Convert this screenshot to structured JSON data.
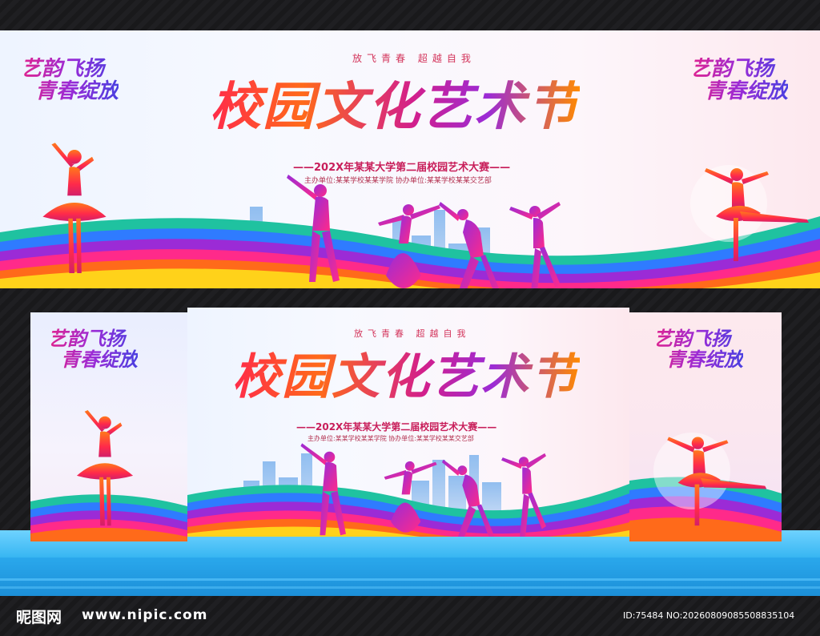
{
  "banner": {
    "slogan_line1": "艺韵飞扬",
    "slogan_line2": "青春绽放",
    "tagline": "放飞青春  超越自我",
    "title": "校园文化艺术节",
    "subtitle": "——202X年某某大学第二届校园艺术大赛——",
    "organizers": "主办单位:某某学校某某学院   协办单位:某某学校某某交艺部"
  },
  "footer": {
    "logo": "昵图网",
    "url": "www.nipic.com",
    "id_text": "ID:75484 NO:20260809085508835104"
  },
  "colors": {
    "background": "#1c1c1e",
    "stage_blue": "#2aa8ec",
    "title_red": "#ff2a4a",
    "title_purple": "#9b2bd6",
    "accent_pink": "#e0248f"
  }
}
